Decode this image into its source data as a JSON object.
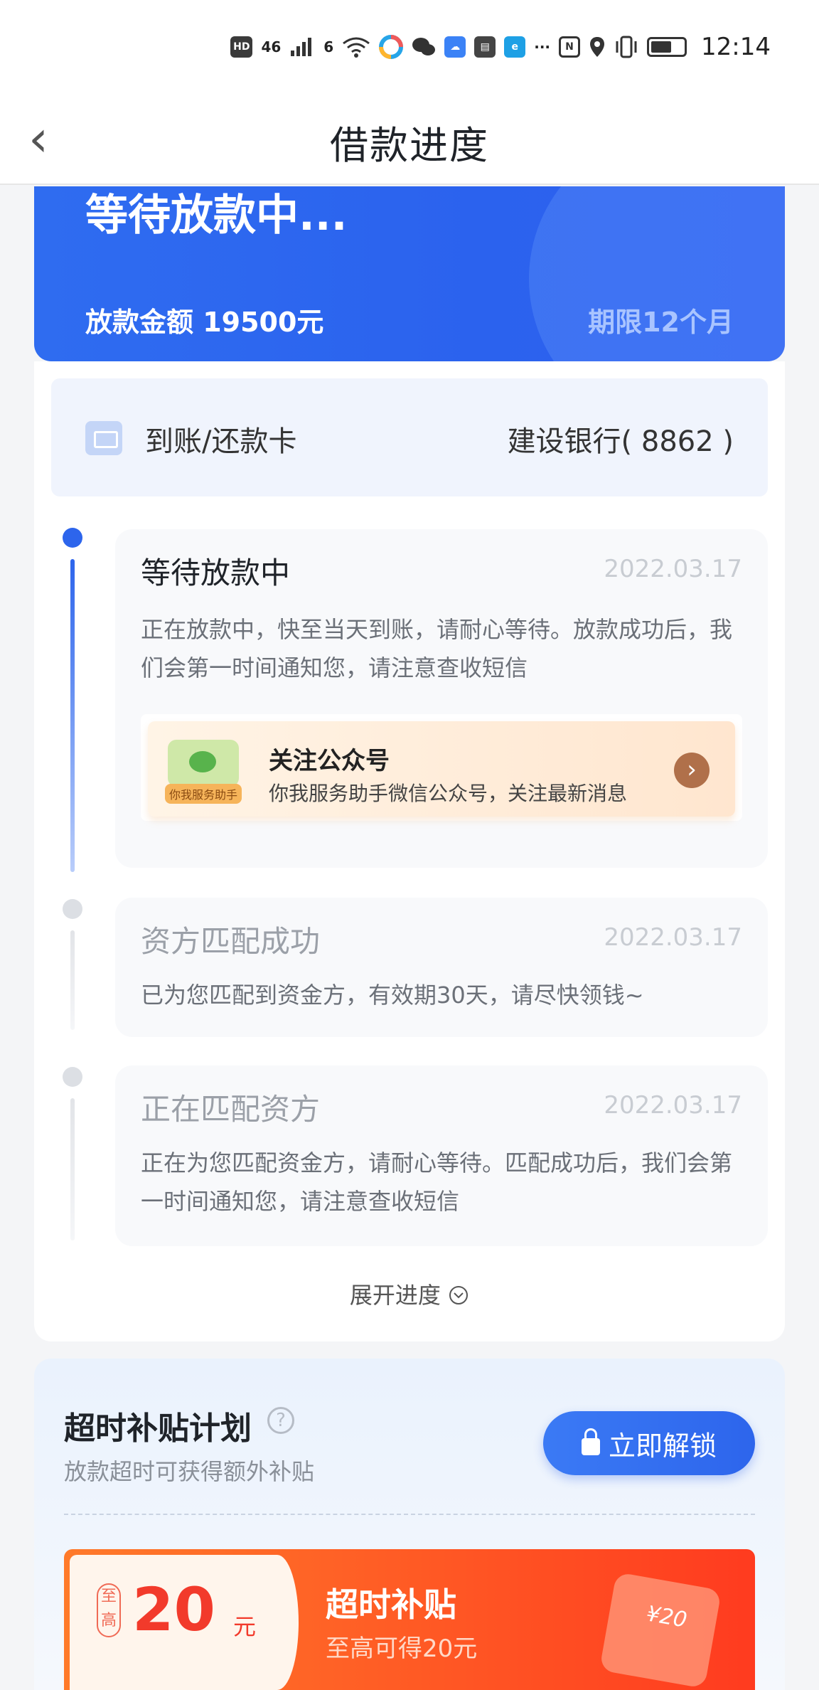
{
  "status_bar": {
    "badges": [
      "HD",
      "46",
      "6"
    ],
    "time": "12:14",
    "icons": [
      "signal-icon",
      "wifi-icon",
      "app-icon",
      "wechat-icon",
      "cloud-icon",
      "huawei-icon",
      "browser-icon",
      "more-icon",
      "nfc-icon",
      "location-icon",
      "vibrate-icon",
      "battery-icon"
    ]
  },
  "nav": {
    "title": "借款进度"
  },
  "loan": {
    "status": "等待放款中...",
    "amount": "放款金额 19500元",
    "term": "期限12个月"
  },
  "bank_card": {
    "label": "到账/还款卡",
    "value": "建设银行( 8862 )"
  },
  "timeline": [
    {
      "title": "等待放款中",
      "date": "2022.03.17",
      "desc": "正在放款中，快至当天到账，请耐心等待。放款成功后，我们会第一时间通知您，请注意查收短信",
      "active": true
    },
    {
      "title": "资方匹配成功",
      "date": "2022.03.17",
      "desc": "已为您匹配到资金方，有效期30天，请尽快领钱~",
      "active": false
    },
    {
      "title": "正在匹配资方",
      "date": "2022.03.17",
      "desc": "正在为您匹配资金方，请耐心等待。匹配成功后，我们会第一时间通知您，请注意查收短信",
      "active": false
    }
  ],
  "follow": {
    "badge": "你我服务助手",
    "title": "关注公众号",
    "subtitle": "你我服务助手微信公众号，关注最新消息"
  },
  "expand_label": "展开进度",
  "subsidy": {
    "title": "超时补贴计划",
    "help": "?",
    "desc": "放款超时可获得额外补贴",
    "unlock_label": "立即解锁",
    "coupon": {
      "tag": "至高",
      "amount": "20",
      "unit": "元",
      "title": "超时补贴",
      "subtitle": "至高可得20元",
      "art_label": "¥20"
    }
  },
  "colors": {
    "primary": "#2b62ee",
    "coupon": "#ff3b1f"
  }
}
